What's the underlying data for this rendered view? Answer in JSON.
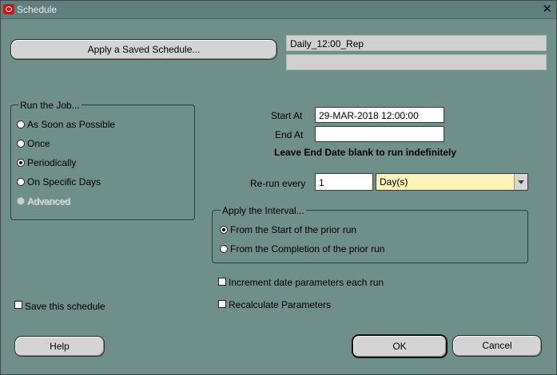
{
  "window": {
    "title": "Schedule",
    "close_glyph": "✕"
  },
  "saved_schedule": {
    "button_label": "Apply a Saved Schedule...",
    "name_value": "Daily_12:00_Rep",
    "description_value": ""
  },
  "run_job": {
    "title": "Run the Job...",
    "options": [
      {
        "label": "As Soon as Possible",
        "selected": false
      },
      {
        "label": "Once",
        "selected": false
      },
      {
        "label": "Periodically",
        "selected": true
      },
      {
        "label": "On Specific Days",
        "selected": false
      },
      {
        "label": "Advanced",
        "selected": false,
        "disabled": true
      }
    ]
  },
  "timing": {
    "start_label": "Start At",
    "start_value": "29-MAR-2018 12:00:00",
    "end_label": "End At",
    "end_value": "",
    "hint": "Leave End Date blank to run indefinitely",
    "rerun_label": "Re-run every",
    "rerun_value": "1",
    "rerun_unit": "Day(s)"
  },
  "interval": {
    "title": "Apply the Interval...",
    "options": [
      {
        "label": "From the Start of the prior run",
        "selected": true
      },
      {
        "label": "From the Completion of the prior run",
        "selected": false
      }
    ]
  },
  "checkboxes": {
    "increment": "Increment date parameters each run",
    "recalculate": "Recalculate Parameters",
    "save": "Save this schedule"
  },
  "footer": {
    "help": "Help",
    "ok": "OK",
    "cancel": "Cancel"
  },
  "colors": {
    "background": "#6f8f8b",
    "dropdown": "#fff3b8",
    "button": "#d4d4d4"
  }
}
